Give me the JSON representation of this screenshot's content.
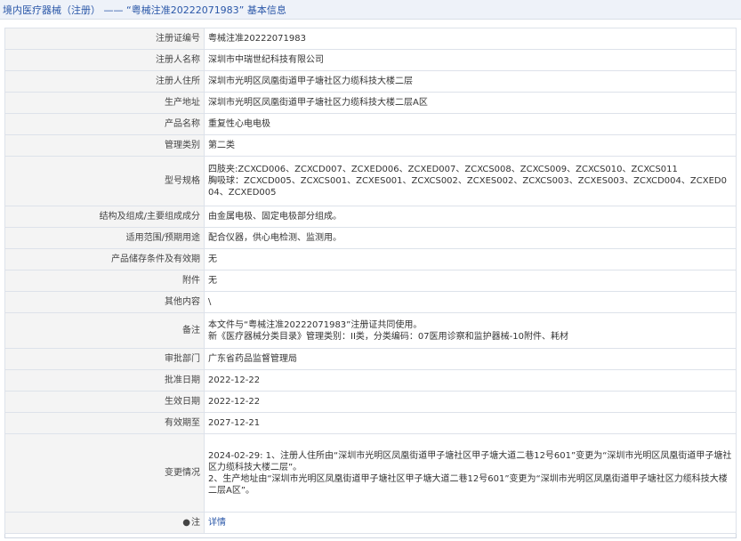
{
  "header": {
    "category": "境内医疗器械（注册）",
    "separator": " —— ",
    "record_title": "“粤械注准20222071983”",
    "suffix": " 基本信息"
  },
  "rows": {
    "reg_no": {
      "label": "注册证编号",
      "value": "粤械注准20222071983"
    },
    "registrant": {
      "label": "注册人名称",
      "value": "深圳市中瑞世纪科技有限公司"
    },
    "address": {
      "label": "注册人住所",
      "value": "深圳市光明区凤凰街道甲子塘社区力缆科技大楼二层"
    },
    "production": {
      "label": "生产地址",
      "value": "深圳市光明区凤凰街道甲子塘社区力缆科技大楼二层A区"
    },
    "product": {
      "label": "产品名称",
      "value": "重复性心电电极"
    },
    "mgmt_class": {
      "label": "管理类别",
      "value": "第二类"
    },
    "model": {
      "label": "型号规格",
      "line1": "四肢夹:ZCXCD006、ZCXCD007、ZCXED006、ZCXED007、ZCXCS008、ZCXCS009、ZCXCS010、ZCXCS011",
      "line2": "胸吸球：ZCXCD005、ZCXCS001、ZCXES001、ZCXCS002、ZCXES002、ZCXCS003、ZCXES003、ZCXCD004、ZCXED004、ZCXED005"
    },
    "structure": {
      "label": "结构及组成/主要组成成分",
      "value": "由金属电极、固定电极部分组成。"
    },
    "scope": {
      "label": "适用范围/预期用途",
      "value": "配合仪器，供心电检测、监测用。"
    },
    "storage": {
      "label": "产品储存条件及有效期",
      "value": "无"
    },
    "accessory": {
      "label": "附件",
      "value": "无"
    },
    "other": {
      "label": "其他内容",
      "value": "\\"
    },
    "remark": {
      "label": "备注",
      "line1": "本文件与“粤械注准20222071983”注册证共同使用。",
      "line2": "新《医疗器械分类目录》管理类别：II类，分类编码：07医用诊察和监护器械-10附件、耗材"
    },
    "approver": {
      "label": "审批部门",
      "value": "广东省药品监督管理局"
    },
    "approve_date": {
      "label": "批准日期",
      "value": "2022-12-22"
    },
    "effective_date": {
      "label": "生效日期",
      "value": "2022-12-22"
    },
    "expiry_date": {
      "label": "有效期至",
      "value": "2027-12-21"
    },
    "changes": {
      "label": "变更情况",
      "item1": "2024-02-29: 1、注册人住所由“深圳市光明区凤凰街道甲子塘社区甲子塘大道二巷12号601”变更为“深圳市光明区凤凰街道甲子塘社区力缆科技大楼二层”。",
      "item2": "2、生产地址由“深圳市光明区凤凰街道甲子塘社区甲子塘大道二巷12号601”变更为“深圳市光明区凤凰街道甲子塘社区力缆科技大楼二层A区”。"
    },
    "note": {
      "pin_icon": "●",
      "label": "注",
      "link": "详情"
    }
  }
}
